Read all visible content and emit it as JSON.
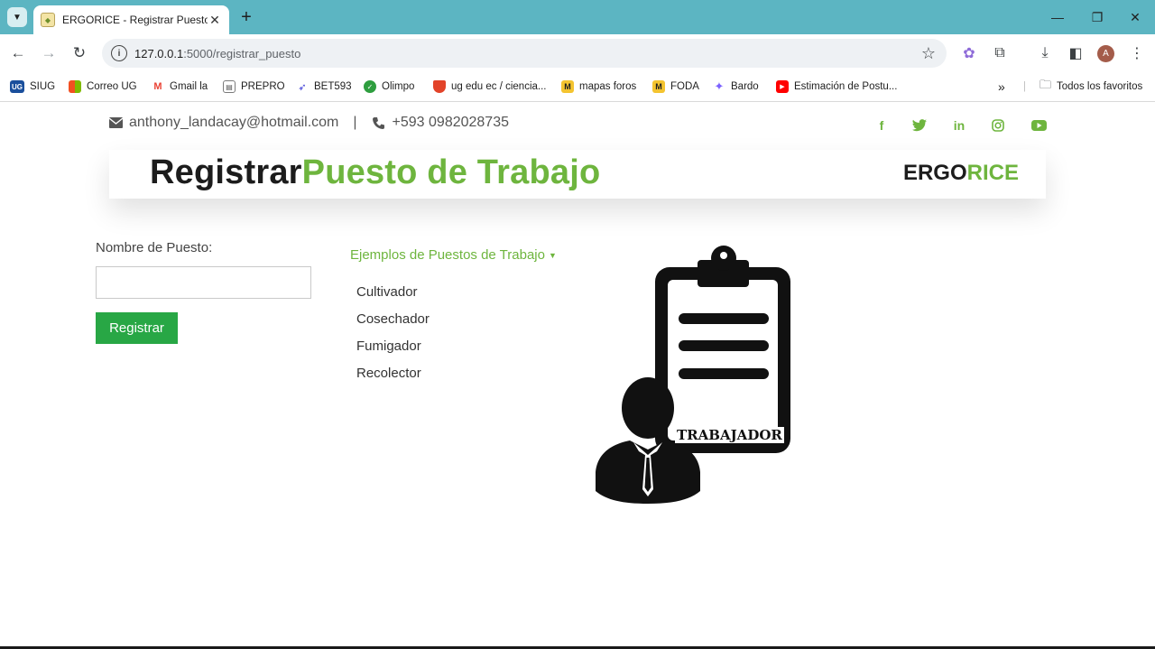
{
  "browser": {
    "tab_title": "ERGORICE - Registrar Puesto",
    "url_host": "127.0.0.1",
    "url_path": ":5000/registrar_puesto",
    "bookmarks": [
      {
        "label": "SIUG",
        "icon": "ug-icon",
        "color": "#1a4f9c"
      },
      {
        "label": "Correo UG",
        "icon": "microsoft-icon",
        "color": "#f25022"
      },
      {
        "label": "Gmail la",
        "icon": "gmail-icon",
        "color": "#ea4335"
      },
      {
        "label": "PREPRO",
        "icon": "document-icon",
        "color": "#7a7a7a"
      },
      {
        "label": "BET593",
        "icon": "bet-icon",
        "color": "#3b3bd6"
      },
      {
        "label": "Olimpo",
        "icon": "olimpo-icon",
        "color": "#2e9e3f"
      },
      {
        "label": "ug edu ec / ciencia...",
        "icon": "gitlab-icon",
        "color": "#e24329"
      },
      {
        "label": "mapas foros",
        "icon": "miro-icon",
        "color": "#f4c430"
      },
      {
        "label": "FODA",
        "icon": "miro-icon",
        "color": "#f4c430"
      },
      {
        "label": "Bardo",
        "icon": "sparkle-icon",
        "color": "#7b61ff"
      },
      {
        "label": "Estimación de Postu...",
        "icon": "youtube-icon",
        "color": "#ff0000"
      }
    ],
    "all_bookmarks_label": "Todos los favoritos",
    "profile_initial": "A"
  },
  "header": {
    "email": "anthony_landacay@hotmail.com",
    "separator": "|",
    "phone": "+593 0982028735",
    "social": [
      "facebook-icon",
      "twitter-icon",
      "linkedin-icon",
      "instagram-icon",
      "youtube-icon"
    ]
  },
  "banner": {
    "title_dark": "Registrar",
    "title_green": "Puesto de Trabajo",
    "brand_dark": "ERGO",
    "brand_green": "RICE"
  },
  "form": {
    "label": "Nombre de Puesto:",
    "value": "",
    "submit_label": "Registrar"
  },
  "examples": {
    "toggle_label": "Ejemplos de Puestos de Trabajo",
    "items": [
      "Cultivador",
      "Cosechador",
      "Fumigador",
      "Recolector"
    ]
  },
  "illustration": {
    "caption": "TRABAJADOR"
  },
  "colors": {
    "accent_green": "#6eb53e",
    "button_green": "#28a745",
    "chrome_teal": "#5cb5c2"
  }
}
